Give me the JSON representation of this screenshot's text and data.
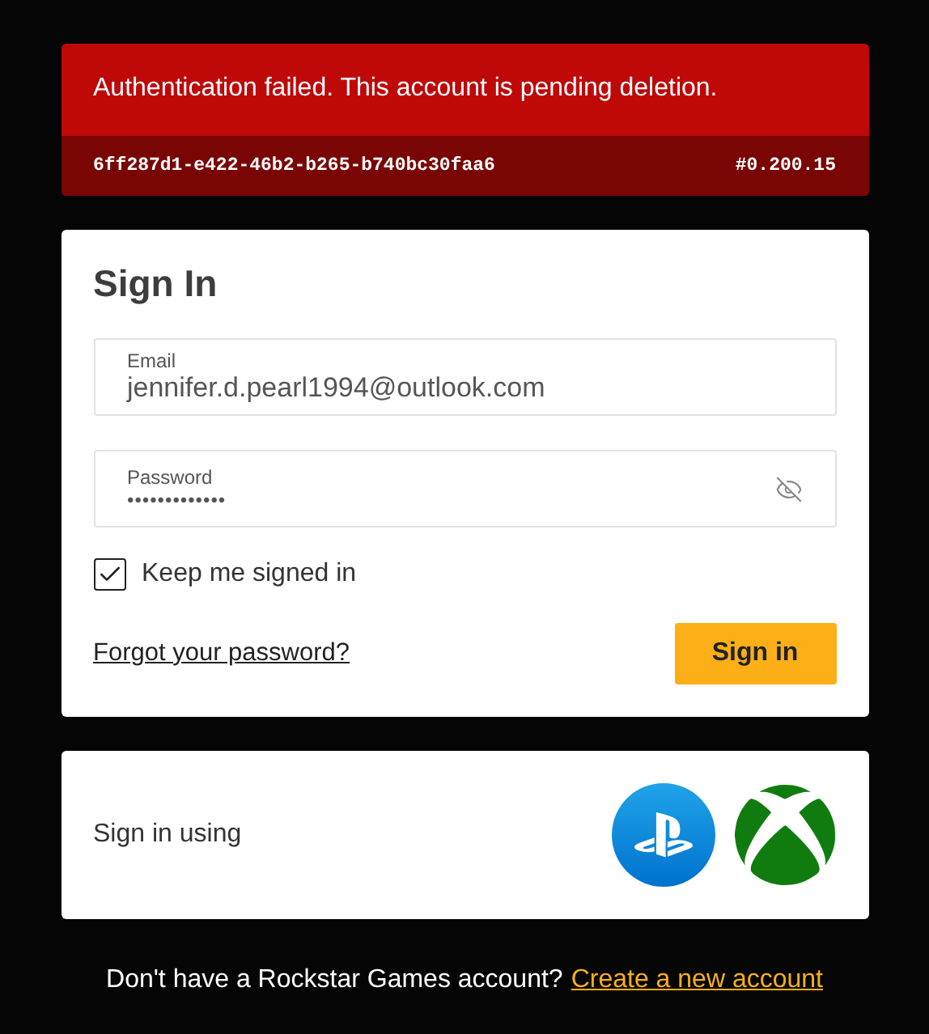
{
  "error": {
    "message": "Authentication failed. This account is pending deletion.",
    "code": "6ff287d1-e422-46b2-b265-b740bc30faa6",
    "version": "#0.200.15"
  },
  "sign_in": {
    "title": "Sign In",
    "fields": [
      {
        "kind": "email",
        "label": "Email",
        "value": "jennifer.d.pearl1994@outlook.com"
      },
      {
        "kind": "password",
        "label": "Password",
        "value": "•••••••••••••"
      }
    ],
    "keep_signed_in": {
      "label": "Keep me signed in",
      "checked": true
    },
    "forgot_link": "Forgot your password?",
    "submit": "Sign in"
  },
  "providers": {
    "label": "Sign in using",
    "items": [
      {
        "kind": "playstation"
      },
      {
        "kind": "xbox"
      }
    ]
  },
  "footer": {
    "text": "Don't have a Rockstar Games account?",
    "link": "Create a new account"
  }
}
